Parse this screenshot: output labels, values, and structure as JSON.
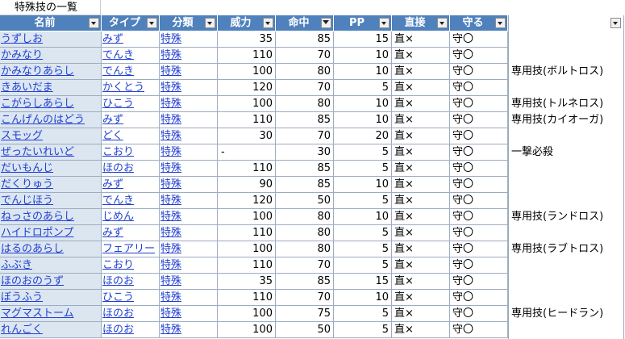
{
  "sheet_title": "特殊技の一覧",
  "headers": [
    "名前",
    "タイプ",
    "分類",
    "威力",
    "命中",
    "PP",
    "直接",
    "守る"
  ],
  "rows": [
    {
      "name": "うずしお",
      "type": "みず",
      "cat": "特殊",
      "power": "35",
      "acc": "85",
      "pp": "15",
      "contact": "直×",
      "protect": "守〇",
      "note": ""
    },
    {
      "name": "かみなり",
      "type": "でんき",
      "cat": "特殊",
      "power": "110",
      "acc": "70",
      "pp": "10",
      "contact": "直×",
      "protect": "守〇",
      "note": ""
    },
    {
      "name": "かみなりあらし",
      "type": "でんき",
      "cat": "特殊",
      "power": "100",
      "acc": "80",
      "pp": "10",
      "contact": "直×",
      "protect": "守〇",
      "note": "専用技(ボルトロス)"
    },
    {
      "name": "きあいだま",
      "type": "かくとう",
      "cat": "特殊",
      "power": "120",
      "acc": "70",
      "pp": "5",
      "contact": "直×",
      "protect": "守〇",
      "note": ""
    },
    {
      "name": "こがらしあらし",
      "type": "ひこう",
      "cat": "特殊",
      "power": "100",
      "acc": "80",
      "pp": "10",
      "contact": "直×",
      "protect": "守〇",
      "note": "専用技(トルネロス)"
    },
    {
      "name": "こんげんのはどう",
      "type": "みず",
      "cat": "特殊",
      "power": "110",
      "acc": "85",
      "pp": "10",
      "contact": "直×",
      "protect": "守〇",
      "note": "専用技(カイオーガ)"
    },
    {
      "name": "スモッグ",
      "type": "どく",
      "cat": "特殊",
      "power": "30",
      "acc": "70",
      "pp": "20",
      "contact": "直×",
      "protect": "守〇",
      "note": ""
    },
    {
      "name": "ぜったいれいど",
      "type": "こおり",
      "cat": "特殊",
      "power": "-",
      "acc": "30",
      "pp": "5",
      "contact": "直×",
      "protect": "守〇",
      "note": "一撃必殺"
    },
    {
      "name": "だいもんじ",
      "type": "ほのお",
      "cat": "特殊",
      "power": "110",
      "acc": "85",
      "pp": "5",
      "contact": "直×",
      "protect": "守〇",
      "note": ""
    },
    {
      "name": "だくりゅう",
      "type": "みず",
      "cat": "特殊",
      "power": "90",
      "acc": "85",
      "pp": "10",
      "contact": "直×",
      "protect": "守〇",
      "note": ""
    },
    {
      "name": "でんじほう",
      "type": "でんき",
      "cat": "特殊",
      "power": "120",
      "acc": "50",
      "pp": "5",
      "contact": "直×",
      "protect": "守〇",
      "note": ""
    },
    {
      "name": "ねっさのあらし",
      "type": "じめん",
      "cat": "特殊",
      "power": "100",
      "acc": "80",
      "pp": "10",
      "contact": "直×",
      "protect": "守〇",
      "note": "専用技(ランドロス)"
    },
    {
      "name": "ハイドロポンプ",
      "type": "みず",
      "cat": "特殊",
      "power": "110",
      "acc": "80",
      "pp": "5",
      "contact": "直×",
      "protect": "守〇",
      "note": ""
    },
    {
      "name": "はるのあらし",
      "type": "フェアリー",
      "cat": "特殊",
      "power": "100",
      "acc": "80",
      "pp": "5",
      "contact": "直×",
      "protect": "守〇",
      "note": "専用技(ラブトロス)"
    },
    {
      "name": "ふぶき",
      "type": "こおり",
      "cat": "特殊",
      "power": "110",
      "acc": "70",
      "pp": "5",
      "contact": "直×",
      "protect": "守〇",
      "note": ""
    },
    {
      "name": "ほのおのうず",
      "type": "ほのお",
      "cat": "特殊",
      "power": "35",
      "acc": "85",
      "pp": "15",
      "contact": "直×",
      "protect": "守〇",
      "note": ""
    },
    {
      "name": "ぼうふう",
      "type": "ひこう",
      "cat": "特殊",
      "power": "110",
      "acc": "70",
      "pp": "10",
      "contact": "直×",
      "protect": "守〇",
      "note": ""
    },
    {
      "name": "マグマストーム",
      "type": "ほのお",
      "cat": "特殊",
      "power": "100",
      "acc": "75",
      "pp": "5",
      "contact": "直×",
      "protect": "守〇",
      "note": "専用技(ヒードラン)"
    },
    {
      "name": "れんごく",
      "type": "ほのお",
      "cat": "特殊",
      "power": "100",
      "acc": "50",
      "pp": "5",
      "contact": "直×",
      "protect": "守〇",
      "note": ""
    }
  ],
  "colors": {
    "header_bg": "#4f81bd",
    "name_bg": "#dce6f1",
    "link": "#1f3fd0",
    "grid": "#9dacc0"
  },
  "icons": {
    "filter_dropdown": "dropdown-arrow-icon",
    "active_filter": "filter-icon"
  }
}
